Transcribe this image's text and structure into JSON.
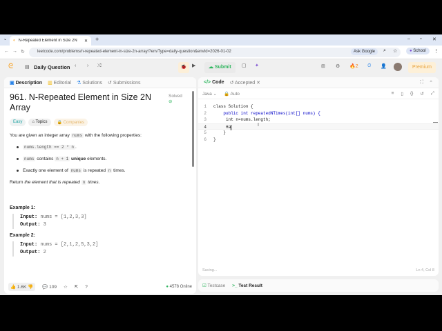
{
  "browser": {
    "tab_title": "N-Repeated Element in Size 2N",
    "url": "leetcode.com/problems/n-repeated-element-in-size-2n-array/?envType=daily-question&envId=2026-01-02",
    "ask_google": "Ask Google",
    "profile": "School"
  },
  "nav": {
    "daily": "Daily Question",
    "submit": "Submit",
    "streak": "2",
    "premium": "Premium"
  },
  "left": {
    "tabs": [
      "Description",
      "Editorial",
      "Solutions",
      "Submissions"
    ],
    "title": "961. N-Repeated Element in Size 2N Array",
    "solved": "Solved",
    "tags": [
      "Easy",
      "Topics",
      "Companies"
    ],
    "intro_a": "You are given an integer array ",
    "intro_code": "nums",
    "intro_b": " with the following properties:",
    "b1_code": "nums.length == 2 * n",
    "b1_end": ".",
    "b2_code": "nums",
    "b2_a": " contains ",
    "b2_code2": "n + 1",
    "b2_bold": " unique",
    "b2_end": " elements.",
    "b3_a": "Exactly one element of ",
    "b3_code": "nums",
    "b3_b": " is repeated ",
    "b3_code2": "n",
    "b3_end": " times.",
    "ret_a": "Return ",
    "ret_i": "the element that is repeated ",
    "ret_code": "n",
    "ret_i2": " times",
    "ex1_title": "Example 1:",
    "ex1_in_label": "Input:",
    "ex1_in": " nums = [1,2,3,3]",
    "ex1_out_label": "Output:",
    "ex1_out": " 3",
    "ex2_title": "Example 2:",
    "ex2_in_label": "Input:",
    "ex2_in": " nums = [2,1,2,5,3,2]",
    "ex2_out_label": "Output:",
    "ex2_out": " 2",
    "likes": "1.6K",
    "comments": "109",
    "online": "4578 Online"
  },
  "right": {
    "tabs": [
      "Code",
      "Accepted"
    ],
    "lang": "Java",
    "auto": "Auto",
    "lines": [
      {
        "n": "1",
        "t": "class Solution {"
      },
      {
        "n": "2",
        "t": "    public int repeatedNTimes(int[] nums) {"
      },
      {
        "n": "3",
        "t": "     int n=nums.length;"
      },
      {
        "n": "4",
        "t": "     Ha"
      },
      {
        "n": "5",
        "t": "    }"
      },
      {
        "n": "6",
        "t": "}"
      }
    ],
    "saving": "Saving...",
    "cursor": "Ln 4, Col 8",
    "testcase": "Testcase",
    "test_result": "Test Result"
  }
}
